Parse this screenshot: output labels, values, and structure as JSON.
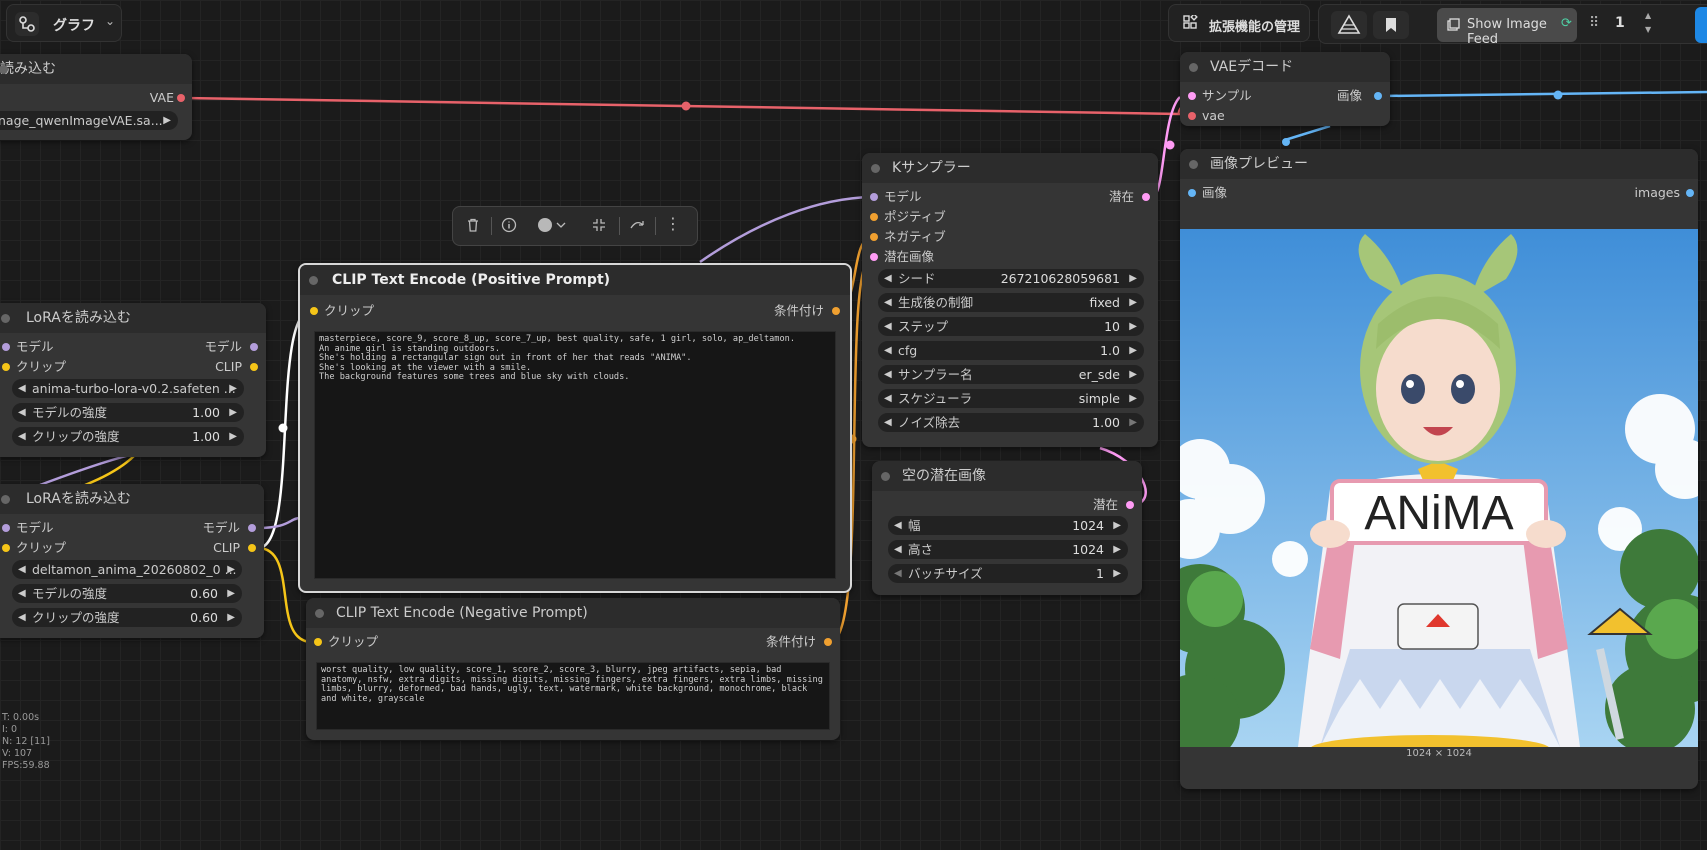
{
  "topbar": {
    "graph_label": "グラフ",
    "extensions_label": "拡張機能の管理",
    "image_feed_label": "Show Image Feed",
    "queue_count": "1"
  },
  "nodes": {
    "vae_loader": {
      "title": "読み込む",
      "out_label": "VAE",
      "file_value": "nage_qwenImageVAE.sa..."
    },
    "vae_decode": {
      "title": "VAEデコード",
      "in_samples": "サンプル",
      "in_vae": "vae",
      "out_image": "画像"
    },
    "ksampler": {
      "title": "Kサンプラー",
      "in_model": "モデル",
      "in_positive": "ポジティブ",
      "in_negative": "ネガティブ",
      "in_latent": "潜在画像",
      "out_latent": "潜在",
      "widgets": [
        {
          "label": "シード",
          "value": "267210628059681"
        },
        {
          "label": "生成後の制御",
          "value": "fixed"
        },
        {
          "label": "ステップ",
          "value": "10"
        },
        {
          "label": "cfg",
          "value": "1.0"
        },
        {
          "label": "サンプラー名",
          "value": "er_sde"
        },
        {
          "label": "スケジューラ",
          "value": "simple"
        },
        {
          "label": "ノイズ除去",
          "value": "1.00"
        }
      ]
    },
    "preview": {
      "title": "画像プレビュー",
      "in_image": "画像",
      "out_images": "images",
      "image_size": "1024 × 1024",
      "sign_text": "ANiMA"
    },
    "empty_latent": {
      "title": "空の潜在画像",
      "out_latent": "潜在",
      "widgets": [
        {
          "label": "幅",
          "value": "1024"
        },
        {
          "label": "高さ",
          "value": "1024"
        },
        {
          "label": "バッチサイズ",
          "value": "1"
        }
      ]
    },
    "clip_positive": {
      "title": "CLIP Text Encode (Positive Prompt)",
      "in_clip": "クリップ",
      "out_cond": "条件付け",
      "text": "masterpiece, score_9, score_8_up, score_7_up, best quality, safe, 1 girl, solo, ap_deltamon.\nAn anime girl is standing outdoors.\nShe's holding a rectangular sign out in front of her that reads \"ANIMA\".\nShe's looking at the viewer with a smile.\nThe background features some trees and blue sky with clouds."
    },
    "clip_negative": {
      "title": "CLIP Text Encode (Negative Prompt)",
      "in_clip": "クリップ",
      "out_cond": "条件付け",
      "text": "worst quality, low quality, score_1, score_2, score_3, blurry, jpeg artifacts, sepia, bad anatomy, nsfw, extra digits, missing digits, missing fingers, extra fingers, extra limbs, missing limbs, blurry, deformed, bad hands, ugly, text, watermark, white background, monochrome, black and white, grayscale"
    },
    "lora1": {
      "title": "LoRAを読み込む",
      "in_model": "モデル",
      "out_model": "モデル",
      "in_clip": "クリップ",
      "out_clip": "CLIP",
      "lora_name": "anima-turbo-lora-v0.2.safeten ...",
      "model_strength_label": "モデルの強度",
      "model_strength": "1.00",
      "clip_strength_label": "クリップの強度",
      "clip_strength": "1.00"
    },
    "lora2": {
      "title": "LoRAを読み込む",
      "in_model": "モデル",
      "out_model": "モデル",
      "in_clip": "クリップ",
      "out_clip": "CLIP",
      "lora_name": "deltamon_anima_20260802_0 ...",
      "model_strength_label": "モデルの強度",
      "model_strength": "0.60",
      "clip_strength_label": "クリップの強度",
      "clip_strength": "0.60"
    }
  },
  "stats": [
    "T: 0.00s",
    "I: 0",
    "N: 12 [11]",
    "V: 107",
    "FPS:59.88"
  ],
  "colors": {
    "vae_wire": "#e8626a",
    "model_wire": "#b39ddb",
    "clip_wire": "#f5c518",
    "cond_wire": "#f0a030",
    "latent_wire": "#ff9cf5",
    "image_wire": "#64b5f6",
    "accent_blue": "#1e88e5"
  }
}
